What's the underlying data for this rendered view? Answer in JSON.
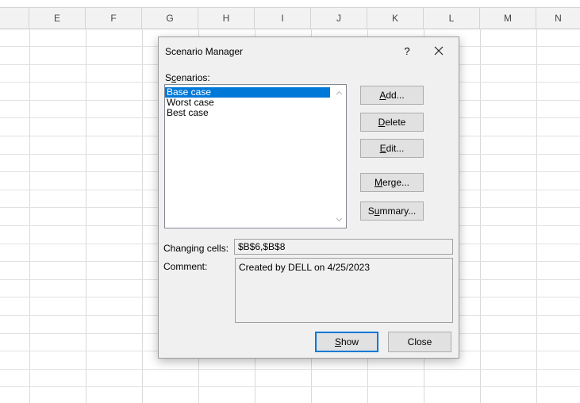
{
  "spreadsheet": {
    "columns": [
      "E",
      "F",
      "G",
      "H",
      "I",
      "J",
      "K",
      "L",
      "M",
      "N"
    ]
  },
  "dialog": {
    "title": "Scenario Manager",
    "help_label": "?",
    "scenarios_label_pre": "S",
    "scenarios_label_u": "c",
    "scenarios_label_post": "enarios:",
    "scenarios": [
      "Base case",
      "Worst case",
      "Best case"
    ],
    "selected_scenario": "Base case",
    "buttons": {
      "add": {
        "pre": "",
        "u": "A",
        "post": "dd..."
      },
      "delete": {
        "pre": "",
        "u": "D",
        "post": "elete"
      },
      "edit": {
        "pre": "",
        "u": "E",
        "post": "dit..."
      },
      "merge": {
        "pre": "",
        "u": "M",
        "post": "erge..."
      },
      "summary": {
        "pre": "S",
        "u": "u",
        "post": "mmary..."
      },
      "show": {
        "pre": "",
        "u": "S",
        "post": "how"
      },
      "close": {
        "pre": "",
        "u": "",
        "post": "Close"
      }
    },
    "changing_cells_label": "Changing cells:",
    "changing_cells_value": "$B$6,$B$8",
    "comment_label": "Comment:",
    "comment_value": "Created by DELL on 4/25/2023"
  }
}
